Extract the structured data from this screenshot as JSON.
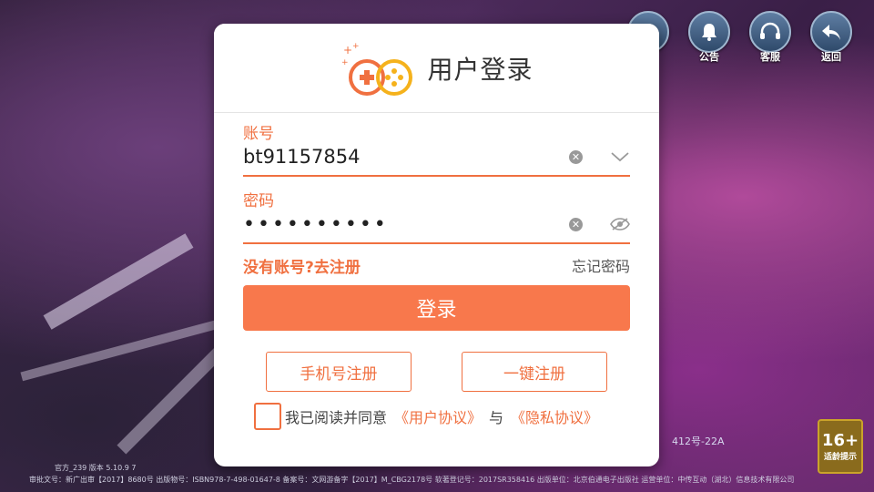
{
  "top_buttons": [
    {
      "label": "",
      "icon": "user-icon"
    },
    {
      "label": "公告",
      "icon": "bell-icon"
    },
    {
      "label": "客服",
      "icon": "headset-icon"
    },
    {
      "label": "返回",
      "icon": "back-arrow-icon"
    }
  ],
  "dialog": {
    "title": "用户登录",
    "account_label": "账号",
    "account_value": "bt91157854",
    "password_label": "密码",
    "password_value": "••••••••••",
    "register_link": "没有账号?去注册",
    "forgot_link": "忘记密码",
    "login_button": "登录",
    "phone_register_button": "手机号注册",
    "quick_register_button": "一键注册",
    "agree_prefix": "我已阅读并同意",
    "user_agreement": "《用户协议》",
    "agree_and": "与",
    "privacy_agreement": "《隐私协议》"
  },
  "footer": {
    "line1": "官方_239  版本 5.10.9 7",
    "line2": "审批文号：新广出审【2017】8680号 出版物号：ISBN978-7-498-01647-8 备案号：文网游备字【2017】M_CBG2178号 软著登记号：2017SR358416 出版单位：北京伯通电子出版社 运营单位：中传互动（湖北）信息技术有限公司",
    "reg_code": "412号-22A"
  },
  "age_badge": {
    "number": "16+",
    "text": "适龄提示"
  },
  "colors": {
    "accent": "#f07040",
    "button": "#f8784c"
  }
}
